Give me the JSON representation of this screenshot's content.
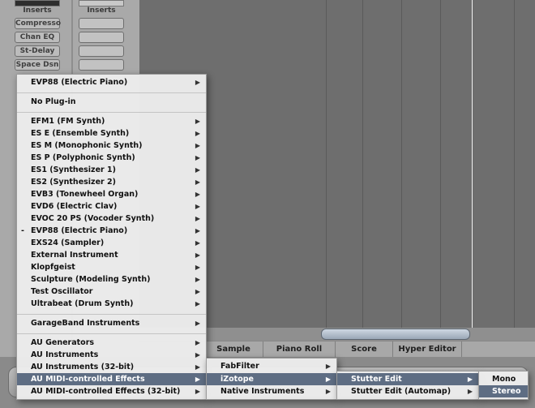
{
  "mixer": {
    "inserts_label_left": "Inserts",
    "inserts_label_right": "Inserts",
    "insert_slots": [
      "Compresso",
      "Chan EQ",
      "St-Delay",
      "Space Dsn"
    ]
  },
  "tabs": [
    "Sample Editor",
    "Piano Roll",
    "Score",
    "Hyper Editor"
  ],
  "main_menu": {
    "header_item": "EVP88  (Electric Piano)",
    "no_plugin": "No Plug-in",
    "instruments": [
      "EFM1  (FM Synth)",
      "ES E  (Ensemble Synth)",
      "ES M  (Monophonic Synth)",
      "ES P  (Polyphonic Synth)",
      "ES1  (Synthesizer 1)",
      "ES2  (Synthesizer 2)",
      "EVB3  (Tonewheel Organ)",
      "EVD6  (Electric Clav)",
      "EVOC 20 PS  (Vocoder Synth)",
      "EVP88  (Electric Piano)",
      "EXS24  (Sampler)",
      "External Instrument",
      "Klopfgeist",
      "Sculpture  (Modeling Synth)",
      "Test Oscillator",
      "Ultrabeat  (Drum Synth)"
    ],
    "checked_mark": "-",
    "garageband": "GarageBand Instruments",
    "au_groups": [
      "AU Generators",
      "AU Instruments",
      "AU Instruments (32-bit)",
      "AU MIDI-controlled Effects",
      "AU MIDI-controlled Effects (32-bit)"
    ]
  },
  "submenu_vendors": [
    "FabFilter",
    "iZotope",
    "Native Instruments"
  ],
  "submenu_izotope": [
    "Stutter Edit",
    "Stutter Edit (Automap)"
  ],
  "submenu_channels": [
    "Mono",
    "Stereo"
  ],
  "icons": {
    "submenu_arrow": "▶"
  }
}
